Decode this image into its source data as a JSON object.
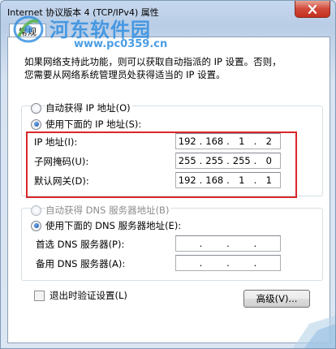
{
  "window": {
    "title": "Internet 协议版本 4 (TCP/IPv4) 属性",
    "close_label": "X"
  },
  "tab": {
    "label": "常规"
  },
  "watermark": {
    "title": "河东软件园",
    "url": "www.pc0359.cn"
  },
  "description": {
    "line1": "如果网络支持此功能，则可以获取自动指派的 IP 设置。否则，",
    "line2": "您需要从网络系统管理员处获得适当的 IP 设置。"
  },
  "ip_mode": {
    "auto_label": "自动获得 IP 地址(O)",
    "manual_label": "使用下面的 IP 地址(S):",
    "selected": "manual"
  },
  "ip_fields": [
    {
      "label": "IP 地址(I):",
      "octets": [
        "192",
        "168",
        "1",
        "2"
      ]
    },
    {
      "label": "子网掩码(U):",
      "octets": [
        "255",
        "255",
        "255",
        "0"
      ]
    },
    {
      "label": "默认网关(D):",
      "octets": [
        "192",
        "168",
        "1",
        "1"
      ]
    }
  ],
  "dns_mode": {
    "auto_label": "自动获得 DNS 服务器地址(B)",
    "manual_label": "使用下面的 DNS 服务器地址(E):",
    "selected": "manual"
  },
  "dns_fields": [
    {
      "label": "首选 DNS 服务器(P):",
      "octets": [
        "",
        "",
        "",
        ""
      ]
    },
    {
      "label": "备用 DNS 服务器(A):",
      "octets": [
        "",
        "",
        "",
        ""
      ]
    }
  ],
  "validate_on_exit": {
    "label": "退出时验证设置(L)",
    "checked": false
  },
  "advanced_button": {
    "label": "高级(V)..."
  },
  "colors": {
    "highlight": "#d9272b",
    "watermark": "#2d8ce0"
  }
}
